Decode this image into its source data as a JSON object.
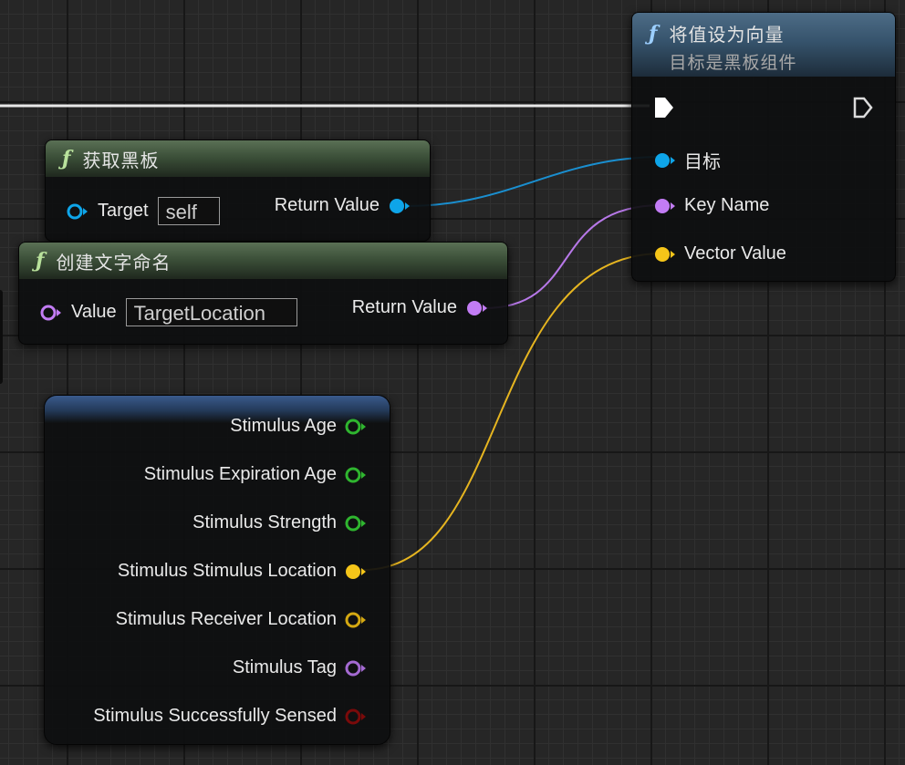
{
  "colors": {
    "object": "#0ea5e9",
    "name": "#c27cf4",
    "vector": "#f5c519",
    "float": "#2fb52f",
    "bool": "#8b0000",
    "exec": "#ffffff"
  },
  "get_blackboard": {
    "icon": "function-icon",
    "title": "获取黑板",
    "target_label": "Target",
    "target_value": "self",
    "return_label": "Return Value"
  },
  "make_literal_name": {
    "icon": "function-icon",
    "title": "创建文字命名",
    "value_label": "Value",
    "value_input": "TargetLocation",
    "return_label": "Return Value"
  },
  "set_value_as_vector": {
    "icon": "function-icon",
    "title": "将值设为向量",
    "subtitle": "目标是黑板组件",
    "pins": [
      "目标",
      "Key Name",
      "Vector Value"
    ]
  },
  "break_stimulus": {
    "pins": [
      {
        "label": "Stimulus Age",
        "type": "float"
      },
      {
        "label": "Stimulus Expiration Age",
        "type": "float"
      },
      {
        "label": "Stimulus Strength",
        "type": "float"
      },
      {
        "label": "Stimulus Stimulus Location",
        "type": "vector"
      },
      {
        "label": "Stimulus Receiver Location",
        "type": "vector"
      },
      {
        "label": "Stimulus Tag",
        "type": "name"
      },
      {
        "label": "Stimulus Successfully Sensed",
        "type": "bool"
      }
    ]
  }
}
